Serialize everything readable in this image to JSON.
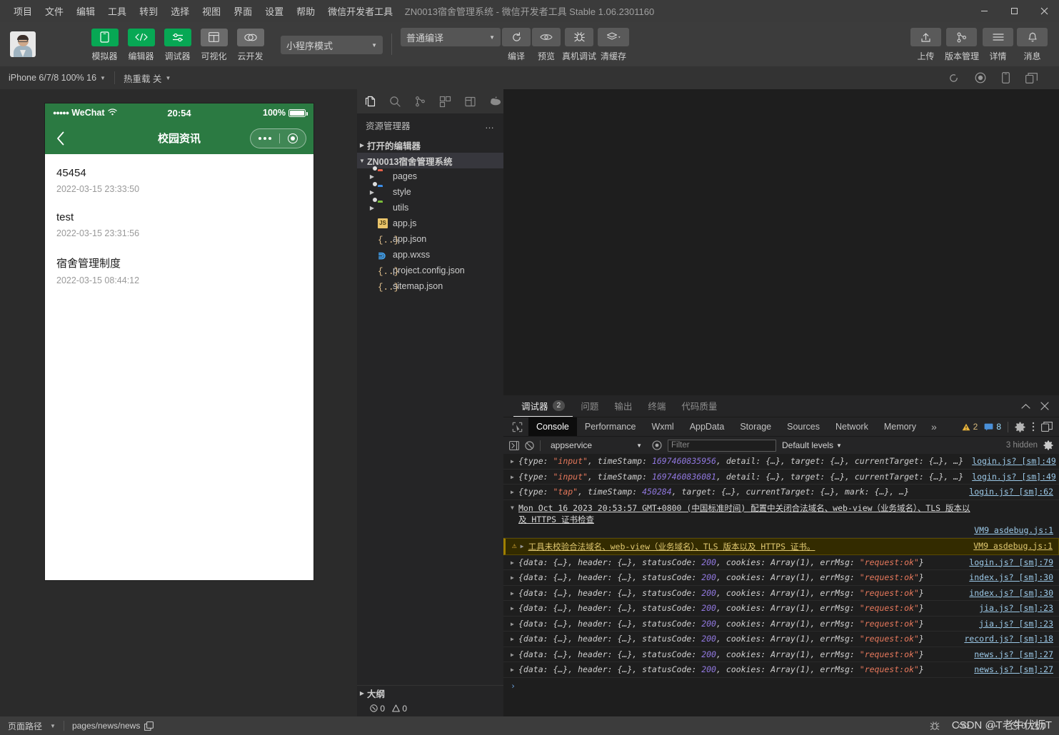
{
  "window": {
    "title": "ZN0013宿舍管理系统 - 微信开发者工具 Stable 1.06.2301160",
    "minimize": "─",
    "maximize": "□",
    "close": "✕"
  },
  "menubar": {
    "items": [
      {
        "label": "项目"
      },
      {
        "label": "文件"
      },
      {
        "label": "编辑"
      },
      {
        "label": "工具"
      },
      {
        "label": "转到"
      },
      {
        "label": "选择"
      },
      {
        "label": "视图"
      },
      {
        "label": "界面"
      },
      {
        "label": "设置"
      },
      {
        "label": "帮助"
      },
      {
        "label": "微信开发者工具"
      }
    ]
  },
  "toolbar": {
    "mode_buttons": [
      {
        "label": "模拟器",
        "icon": "phone-icon",
        "state": "active"
      },
      {
        "label": "编辑器",
        "icon": "code-icon",
        "state": "active"
      },
      {
        "label": "调试器",
        "icon": "sliders-icon",
        "state": "active"
      },
      {
        "label": "可视化",
        "icon": "layout-icon",
        "state": "inactive"
      },
      {
        "label": "云开发",
        "icon": "cloud-icon",
        "state": "inactive"
      }
    ],
    "project_mode": "小程序模式",
    "compile_mode": "普通编译",
    "actions": [
      {
        "label": "编译",
        "icon": "refresh-icon"
      },
      {
        "label": "预览",
        "icon": "eye-icon"
      },
      {
        "label": "真机调试",
        "icon": "bug-icon"
      },
      {
        "label": "清缓存",
        "icon": "layers-icon"
      }
    ],
    "right_buttons": [
      {
        "label": "上传",
        "icon": "upload-icon"
      },
      {
        "label": "版本管理",
        "icon": "branch-icon"
      },
      {
        "label": "详情",
        "icon": "menu-icon"
      },
      {
        "label": "消息",
        "icon": "bell-icon"
      }
    ]
  },
  "subbar": {
    "device": "iPhone 6/7/8 100% 16",
    "hot_reload": "热重载 关",
    "icons": [
      "refresh-icon",
      "record-icon",
      "phone-icon",
      "window-icon"
    ]
  },
  "simulator": {
    "status": {
      "carrier": "WeChat",
      "signal_dots": "●●●●●",
      "time": "20:54",
      "battery": "100%"
    },
    "nav": {
      "back_icon": "chevron-left-icon",
      "title": "校园资讯",
      "capsule_menu_icon": "more-dots-icon",
      "capsule_close_icon": "target-icon"
    },
    "news_list": [
      {
        "title": "45454",
        "date": "2022-03-15 23:33:50"
      },
      {
        "title": "test",
        "date": "2022-03-15 23:31:56"
      },
      {
        "title": "宿舍管理制度",
        "date": "2022-03-15 08:44:12"
      }
    ]
  },
  "explorer": {
    "activity_icons": [
      {
        "name": "files-icon",
        "active": true
      },
      {
        "name": "search-icon",
        "active": false
      },
      {
        "name": "source-control-icon",
        "active": false
      },
      {
        "name": "extensions-icon",
        "active": false
      },
      {
        "name": "plugin-icon",
        "active": false
      },
      {
        "name": "debug-cloud-icon",
        "active": false
      }
    ],
    "header": "资源管理器",
    "header_more": "…",
    "open_editors": "打开的编辑器",
    "project_root": "ZN0013宿舍管理系统",
    "tree": [
      {
        "label": "pages",
        "type": "folder",
        "color": "#e8624a",
        "indent": 2,
        "expandable": true
      },
      {
        "label": "style",
        "type": "folder",
        "color": "#3b8eea",
        "indent": 2,
        "expandable": true
      },
      {
        "label": "utils",
        "type": "folder",
        "color": "#7bbf3a",
        "indent": 2,
        "expandable": true
      },
      {
        "label": "app.js",
        "type": "js",
        "indent": 2,
        "expandable": false
      },
      {
        "label": "app.json",
        "type": "json",
        "indent": 2,
        "expandable": false
      },
      {
        "label": "app.wxss",
        "type": "wxss",
        "indent": 2,
        "expandable": false
      },
      {
        "label": "project.config.json",
        "type": "json",
        "indent": 2,
        "expandable": false
      },
      {
        "label": "sitemap.json",
        "type": "json",
        "indent": 2,
        "expandable": false
      }
    ],
    "outline": "大纲",
    "errors": "0",
    "warnings": "0"
  },
  "devtools": {
    "panel_tabs": [
      {
        "label": "调试器",
        "badge": "2",
        "active": true
      },
      {
        "label": "问题",
        "badge": "",
        "active": false
      },
      {
        "label": "输出",
        "badge": "",
        "active": false
      },
      {
        "label": "终端",
        "badge": "",
        "active": false
      },
      {
        "label": "代码质量",
        "badge": "",
        "active": false
      }
    ],
    "panel_collapse_icon": "chevron-up-icon",
    "panel_close_icon": "close-icon",
    "tabs": [
      {
        "label": "Console",
        "active": true
      },
      {
        "label": "Performance",
        "active": false
      },
      {
        "label": "Wxml",
        "active": false
      },
      {
        "label": "AppData",
        "active": false
      },
      {
        "label": "Storage",
        "active": false
      },
      {
        "label": "Sources",
        "active": false
      },
      {
        "label": "Network",
        "active": false
      },
      {
        "label": "Memory",
        "active": false
      }
    ],
    "more_tabs": "»",
    "warning_count": "2",
    "message_count": "8",
    "console_bar": {
      "context": "appservice",
      "filter_placeholder": "Filter",
      "levels": "Default levels",
      "hidden": "3 hidden"
    },
    "logs": [
      {
        "kind": "object",
        "parts": [
          {
            "t": "{type: ",
            "c": "plain"
          },
          {
            "t": "\"input\"",
            "c": "str"
          },
          {
            "t": ", timeStamp: ",
            "c": "plain"
          },
          {
            "t": "1697460835956",
            "c": "num"
          },
          {
            "t": ", detail: {…}, target: {…}, currentTarget: {…}, …}",
            "c": "plain"
          }
        ],
        "source": "login.js? [sm]:49"
      },
      {
        "kind": "object",
        "parts": [
          {
            "t": "{type: ",
            "c": "plain"
          },
          {
            "t": "\"input\"",
            "c": "str"
          },
          {
            "t": ", timeStamp: ",
            "c": "plain"
          },
          {
            "t": "1697460836081",
            "c": "num"
          },
          {
            "t": ", detail: {…}, target: {…}, currentTarget: {…}, …}",
            "c": "plain"
          }
        ],
        "source": "login.js? [sm]:49"
      },
      {
        "kind": "object",
        "parts": [
          {
            "t": "{type: ",
            "c": "plain"
          },
          {
            "t": "\"tap\"",
            "c": "str"
          },
          {
            "t": ", timeStamp: ",
            "c": "plain"
          },
          {
            "t": "450284",
            "c": "num"
          },
          {
            "t": ", target: {…}, currentTarget: {…}, mark: {…}, …}",
            "c": "plain"
          }
        ],
        "source": "login.js? [sm]:62"
      },
      {
        "kind": "group",
        "text": "Mon Oct 16 2023 20:53:57 GMT+0800 (中国标准时间) 配置中关闭合法域名、web-view（业务域名）、TLS 版本以及 HTTPS 证书检查",
        "source": "VM9 asdebug.js:1"
      },
      {
        "kind": "warning",
        "text": "工具未校验合法域名、web-view（业务域名）、TLS 版本以及 HTTPS 证书。",
        "source": "VM9 asdebug.js:1"
      },
      {
        "kind": "object",
        "parts": [
          {
            "t": "{data: {…}, header: {…}, statusCode: ",
            "c": "plain"
          },
          {
            "t": "200",
            "c": "num"
          },
          {
            "t": ", cookies: Array(1), errMsg: ",
            "c": "plain"
          },
          {
            "t": "\"request:ok\"",
            "c": "str"
          },
          {
            "t": "}",
            "c": "plain"
          }
        ],
        "source": "login.js? [sm]:79"
      },
      {
        "kind": "object",
        "parts": [
          {
            "t": "{data: {…}, header: {…}, statusCode: ",
            "c": "plain"
          },
          {
            "t": "200",
            "c": "num"
          },
          {
            "t": ", cookies: Array(1), errMsg: ",
            "c": "plain"
          },
          {
            "t": "\"request:ok\"",
            "c": "str"
          },
          {
            "t": "}",
            "c": "plain"
          }
        ],
        "source": "index.js? [sm]:30"
      },
      {
        "kind": "object",
        "parts": [
          {
            "t": "{data: {…}, header: {…}, statusCode: ",
            "c": "plain"
          },
          {
            "t": "200",
            "c": "num"
          },
          {
            "t": ", cookies: Array(1), errMsg: ",
            "c": "plain"
          },
          {
            "t": "\"request:ok\"",
            "c": "str"
          },
          {
            "t": "}",
            "c": "plain"
          }
        ],
        "source": "index.js? [sm]:30"
      },
      {
        "kind": "object",
        "parts": [
          {
            "t": "{data: {…}, header: {…}, statusCode: ",
            "c": "plain"
          },
          {
            "t": "200",
            "c": "num"
          },
          {
            "t": ", cookies: Array(1), errMsg: ",
            "c": "plain"
          },
          {
            "t": "\"request:ok\"",
            "c": "str"
          },
          {
            "t": "}",
            "c": "plain"
          }
        ],
        "source": "jia.js? [sm]:23"
      },
      {
        "kind": "object",
        "parts": [
          {
            "t": "{data: {…}, header: {…}, statusCode: ",
            "c": "plain"
          },
          {
            "t": "200",
            "c": "num"
          },
          {
            "t": ", cookies: Array(1), errMsg: ",
            "c": "plain"
          },
          {
            "t": "\"request:ok\"",
            "c": "str"
          },
          {
            "t": "}",
            "c": "plain"
          }
        ],
        "source": "jia.js? [sm]:23"
      },
      {
        "kind": "object",
        "parts": [
          {
            "t": "{data: {…}, header: {…}, statusCode: ",
            "c": "plain"
          },
          {
            "t": "200",
            "c": "num"
          },
          {
            "t": ", cookies: Array(1), errMsg: ",
            "c": "plain"
          },
          {
            "t": "\"request:ok\"",
            "c": "str"
          },
          {
            "t": "}",
            "c": "plain"
          }
        ],
        "source": "record.js? [sm]:18"
      },
      {
        "kind": "object",
        "parts": [
          {
            "t": "{data: {…}, header: {…}, statusCode: ",
            "c": "plain"
          },
          {
            "t": "200",
            "c": "num"
          },
          {
            "t": ", cookies: Array(1), errMsg: ",
            "c": "plain"
          },
          {
            "t": "\"request:ok\"",
            "c": "str"
          },
          {
            "t": "}",
            "c": "plain"
          }
        ],
        "source": "news.js? [sm]:27"
      },
      {
        "kind": "object",
        "parts": [
          {
            "t": "{data: {…}, header: {…}, statusCode: ",
            "c": "plain"
          },
          {
            "t": "200",
            "c": "num"
          },
          {
            "t": ", cookies: Array(1), errMsg: ",
            "c": "plain"
          },
          {
            "t": "\"request:ok\"",
            "c": "str"
          },
          {
            "t": "}",
            "c": "plain"
          }
        ],
        "source": "news.js? [sm]:27"
      }
    ],
    "prompt": "›"
  },
  "statusbar": {
    "page_path_label": "页面路径",
    "page_path": "pages/news/news",
    "copy_icon": "copy-icon",
    "icons": [
      "bug-icon",
      "eye-icon",
      "more-icon"
    ],
    "errors": "0",
    "warnings": "0",
    "watermark": "CSDN @T老牛伏枥T"
  }
}
